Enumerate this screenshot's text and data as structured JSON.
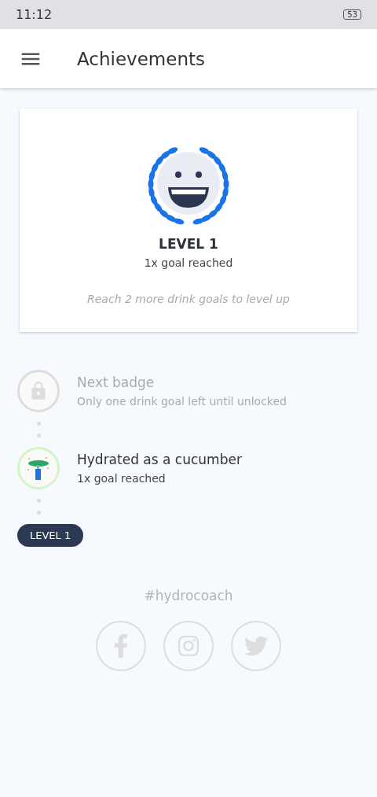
{
  "status_bar": {
    "time": "11:12",
    "battery": "53"
  },
  "app_bar": {
    "title": "Achievements"
  },
  "level_card": {
    "level": "LEVEL 1",
    "goals": "1x goal reached",
    "hint": "Reach 2 more drink goals to level up"
  },
  "badges": [
    {
      "kind": "locked",
      "title": "Next badge",
      "subtitle": "Only one drink goal left until unlocked"
    },
    {
      "kind": "unlocked",
      "title": "Hydrated as a cucumber",
      "subtitle": "1x goal reached"
    }
  ],
  "level_pill": "LEVEL 1",
  "footer": {
    "hashtag": "#hydrocoach"
  }
}
